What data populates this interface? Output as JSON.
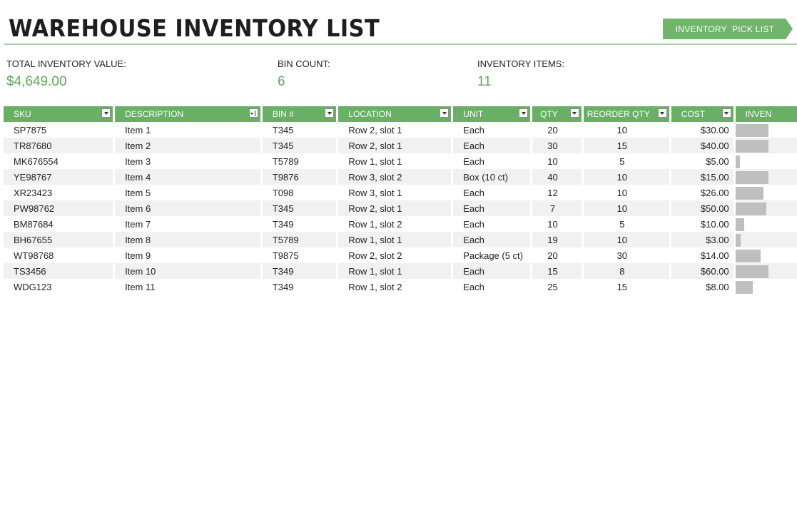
{
  "title": "WAREHOUSE INVENTORY LIST",
  "pick_list_button": "INVENTORY  PICK LIST",
  "stats": [
    {
      "label": "TOTAL INVENTORY VALUE:",
      "value": "$4,649.00"
    },
    {
      "label": "BIN COUNT:",
      "value": "6"
    },
    {
      "label": "INVENTORY ITEMS:",
      "value": "11"
    }
  ],
  "colors": {
    "accent": "#6aaf66",
    "stat_value": "#5fa85b",
    "bar": "#bfbfbf",
    "row_alt": "#f1f1f1"
  },
  "table": {
    "headers": [
      "SKU",
      "DESCRIPTION",
      "BIN #",
      "LOCATION",
      "UNIT",
      "QTY",
      "REORDER QTY",
      "COST",
      "INVEN"
    ],
    "rows": [
      {
        "sku": "SP7875",
        "desc": "Item 1",
        "bin": "T345",
        "loc": "Row 2, slot 1",
        "unit": "Each",
        "qty": "20",
        "reorder": "10",
        "cost": "$30.00",
        "inv_fraction": 1.0
      },
      {
        "sku": "TR87680",
        "desc": "Item 2",
        "bin": "T345",
        "loc": "Row 2, slot 1",
        "unit": "Each",
        "qty": "30",
        "reorder": "15",
        "cost": "$40.00",
        "inv_fraction": 1.0
      },
      {
        "sku": "MK676554",
        "desc": "Item 3",
        "bin": "T5789",
        "loc": "Row 1, slot 1",
        "unit": "Each",
        "qty": "10",
        "reorder": "5",
        "cost": "$5.00",
        "inv_fraction": 0.12
      },
      {
        "sku": "YE98767",
        "desc": "Item 4",
        "bin": "T9876",
        "loc": "Row 3, slot 2",
        "unit": "Box (10 ct)",
        "qty": "40",
        "reorder": "10",
        "cost": "$15.00",
        "inv_fraction": 1.0
      },
      {
        "sku": "XR23423",
        "desc": "Item 5",
        "bin": "T098",
        "loc": "Row 3, slot 1",
        "unit": "Each",
        "qty": "12",
        "reorder": "10",
        "cost": "$26.00",
        "inv_fraction": 0.84
      },
      {
        "sku": "PW98762",
        "desc": "Item 6",
        "bin": "T345",
        "loc": "Row 2, slot 1",
        "unit": "Each",
        "qty": "7",
        "reorder": "10",
        "cost": "$50.00",
        "inv_fraction": 0.93
      },
      {
        "sku": "BM87684",
        "desc": "Item 7",
        "bin": "T349",
        "loc": "Row 1, slot 2",
        "unit": "Each",
        "qty": "10",
        "reorder": "5",
        "cost": "$10.00",
        "inv_fraction": 0.26
      },
      {
        "sku": "BH67655",
        "desc": "Item 8",
        "bin": "T5789",
        "loc": "Row 1, slot 1",
        "unit": "Each",
        "qty": "19",
        "reorder": "10",
        "cost": "$3.00",
        "inv_fraction": 0.15
      },
      {
        "sku": "WT98768",
        "desc": "Item 9",
        "bin": "T9875",
        "loc": "Row 2, slot 2",
        "unit": "Package (5 ct)",
        "qty": "20",
        "reorder": "30",
        "cost": "$14.00",
        "inv_fraction": 0.76
      },
      {
        "sku": "TS3456",
        "desc": "Item 10",
        "bin": "T349",
        "loc": "Row 1, slot 1",
        "unit": "Each",
        "qty": "15",
        "reorder": "8",
        "cost": "$60.00",
        "inv_fraction": 1.0
      },
      {
        "sku": "WDG123",
        "desc": "Item 11",
        "bin": "T349",
        "loc": "Row 1, slot 2",
        "unit": "Each",
        "qty": "25",
        "reorder": "15",
        "cost": "$8.00",
        "inv_fraction": 0.53
      }
    ]
  }
}
